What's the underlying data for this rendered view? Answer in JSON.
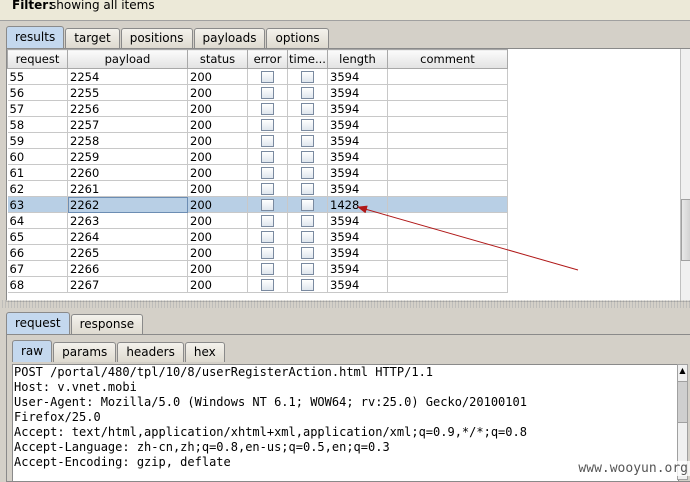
{
  "filter": {
    "label": "Filter:",
    "text": "showing all items"
  },
  "top_tabs": [
    "results",
    "target",
    "positions",
    "payloads",
    "options"
  ],
  "table": {
    "columns": [
      "request",
      "payload",
      "status",
      "error",
      "time...",
      "length",
      "comment"
    ],
    "rows": [
      {
        "request": "55",
        "payload": "2254",
        "status": "200",
        "length": "3594"
      },
      {
        "request": "56",
        "payload": "2255",
        "status": "200",
        "length": "3594"
      },
      {
        "request": "57",
        "payload": "2256",
        "status": "200",
        "length": "3594"
      },
      {
        "request": "58",
        "payload": "2257",
        "status": "200",
        "length": "3594"
      },
      {
        "request": "59",
        "payload": "2258",
        "status": "200",
        "length": "3594"
      },
      {
        "request": "60",
        "payload": "2259",
        "status": "200",
        "length": "3594"
      },
      {
        "request": "61",
        "payload": "2260",
        "status": "200",
        "length": "3594"
      },
      {
        "request": "62",
        "payload": "2261",
        "status": "200",
        "length": "3594"
      },
      {
        "request": "63",
        "payload": "2262",
        "status": "200",
        "length": "1428",
        "selected": true
      },
      {
        "request": "64",
        "payload": "2263",
        "status": "200",
        "length": "3594"
      },
      {
        "request": "65",
        "payload": "2264",
        "status": "200",
        "length": "3594"
      },
      {
        "request": "66",
        "payload": "2265",
        "status": "200",
        "length": "3594"
      },
      {
        "request": "67",
        "payload": "2266",
        "status": "200",
        "length": "3594"
      },
      {
        "request": "68",
        "payload": "2267",
        "status": "200",
        "length": "3594"
      }
    ]
  },
  "detail_tabs": [
    "request",
    "response"
  ],
  "view_tabs": [
    "raw",
    "params",
    "headers",
    "hex"
  ],
  "request_lines": [
    "POST /portal/480/tpl/10/8/userRegisterAction.html HTTP/1.1",
    "Host: v.vnet.mobi",
    "User-Agent: Mozilla/5.0 (Windows NT 6.1; WOW64; rv:25.0) Gecko/20100101",
    "Firefox/25.0",
    "Accept: text/html,application/xhtml+xml,application/xml;q=0.9,*/*;q=0.8",
    "Accept-Language: zh-cn,zh;q=0.8,en-us;q=0.5,en;q=0.3",
    "Accept-Encoding: gzip, deflate"
  ],
  "watermark": "www.wooyun.org",
  "colors": {
    "selected_row": "#b8cfe5",
    "active_tab": "#c4d8ee",
    "annotation_arrow": "#b01818"
  }
}
